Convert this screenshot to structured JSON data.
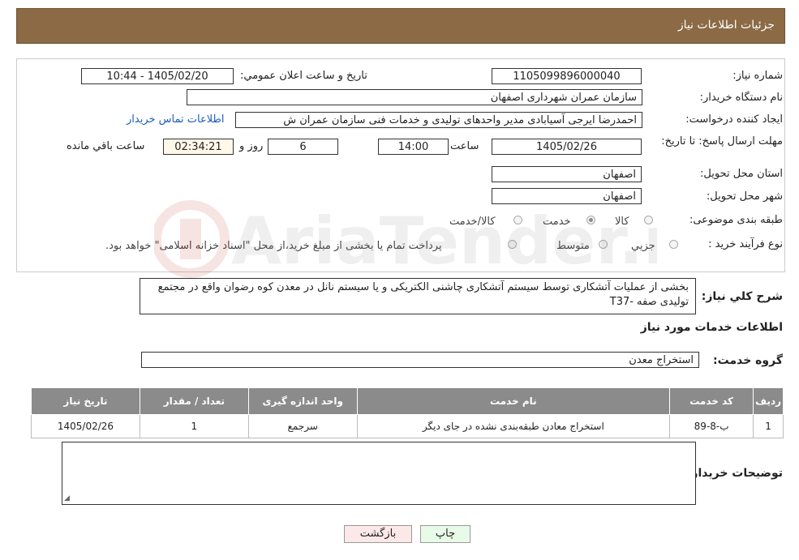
{
  "header": {
    "title": "جزئیات اطلاعات نیاز"
  },
  "fields": {
    "need_number_label": "شماره نياز:",
    "need_number": "1105099896000040",
    "announce_label": "تاريخ و ساعت اعلان عمومي:",
    "announce_value": "1405/02/20 - 10:44",
    "buyer_org_label": "نام دستگاه خريدار:",
    "buyer_org": "سازمان عمران شهرداری اصفهان",
    "creator_label": "ايجاد کننده درخواست:",
    "creator": "احمدرضا ایرجی آسیابادی مدیر واحدهای تولیدی و خدمات فنی سازمان عمران ش",
    "contact_link": "اطلاعات تماس خريدار",
    "deadline_label": "مهلت ارسال پاسخ: تا تاريخ:",
    "deadline_date": "1405/02/26",
    "time_label": "ساعت",
    "deadline_time": "14:00",
    "days_value": "6",
    "days_label": "روز و",
    "remaining_value": "02:34:21",
    "remaining_label": "ساعت باقي مانده",
    "province_label": "استان محل تحويل:",
    "province": "اصفهان",
    "city_label": "شهر محل تحويل:",
    "city": "اصفهان",
    "category_label": "طبقه بندی موضوعی:",
    "category_options": [
      "کالا",
      "خدمت",
      "کالا/خدمت"
    ],
    "category_selected": "خدمت",
    "process_label": "نوع فرآيند خريد :",
    "process_options": [
      "جزيي",
      "متوسط"
    ],
    "payment_note": "پرداخت تمام يا بخشی از مبلغ خريد،از محل \"اسناد خزانه اسلامی\" خواهد بود."
  },
  "description": {
    "label": "شرح کلي نياز:",
    "text": "بخشی از عملیات آتشکاری توسط سیستم آتشکاری چاشنی الکتریکی و یا سیستم نانل در معدن کوه رضوان واقع در مجتمع تولیدی صفه -T37"
  },
  "services_section": {
    "title": "اطلاعات خدمات مورد نياز",
    "group_label": "گروه خدمت:",
    "group_value": "استخراج معدن"
  },
  "table": {
    "headers": [
      "رديف",
      "کد خدمت",
      "نام خدمت",
      "واحد اندازه گيری",
      "تعداد / مقدار",
      "تاريخ نياز"
    ],
    "rows": [
      [
        "1",
        "ب-8-89",
        "استخراج معادن طبقه‌بندی نشده در جای دیگر",
        "سرجمع",
        "1",
        "1405/02/26"
      ]
    ]
  },
  "buyer_notes": {
    "label": "توضيحات خريدار:",
    "value": ""
  },
  "buttons": {
    "print": "چاپ",
    "back": "بازگشت"
  },
  "colors": {
    "header_bg": "#8b6a45",
    "table_header_bg": "#8b8b8b",
    "link": "#1a5dbf",
    "back_btn_bg": "#fde8e8",
    "print_btn_bg": "#e8fbe8"
  },
  "watermark": {
    "text": "AriaTender.neT"
  }
}
